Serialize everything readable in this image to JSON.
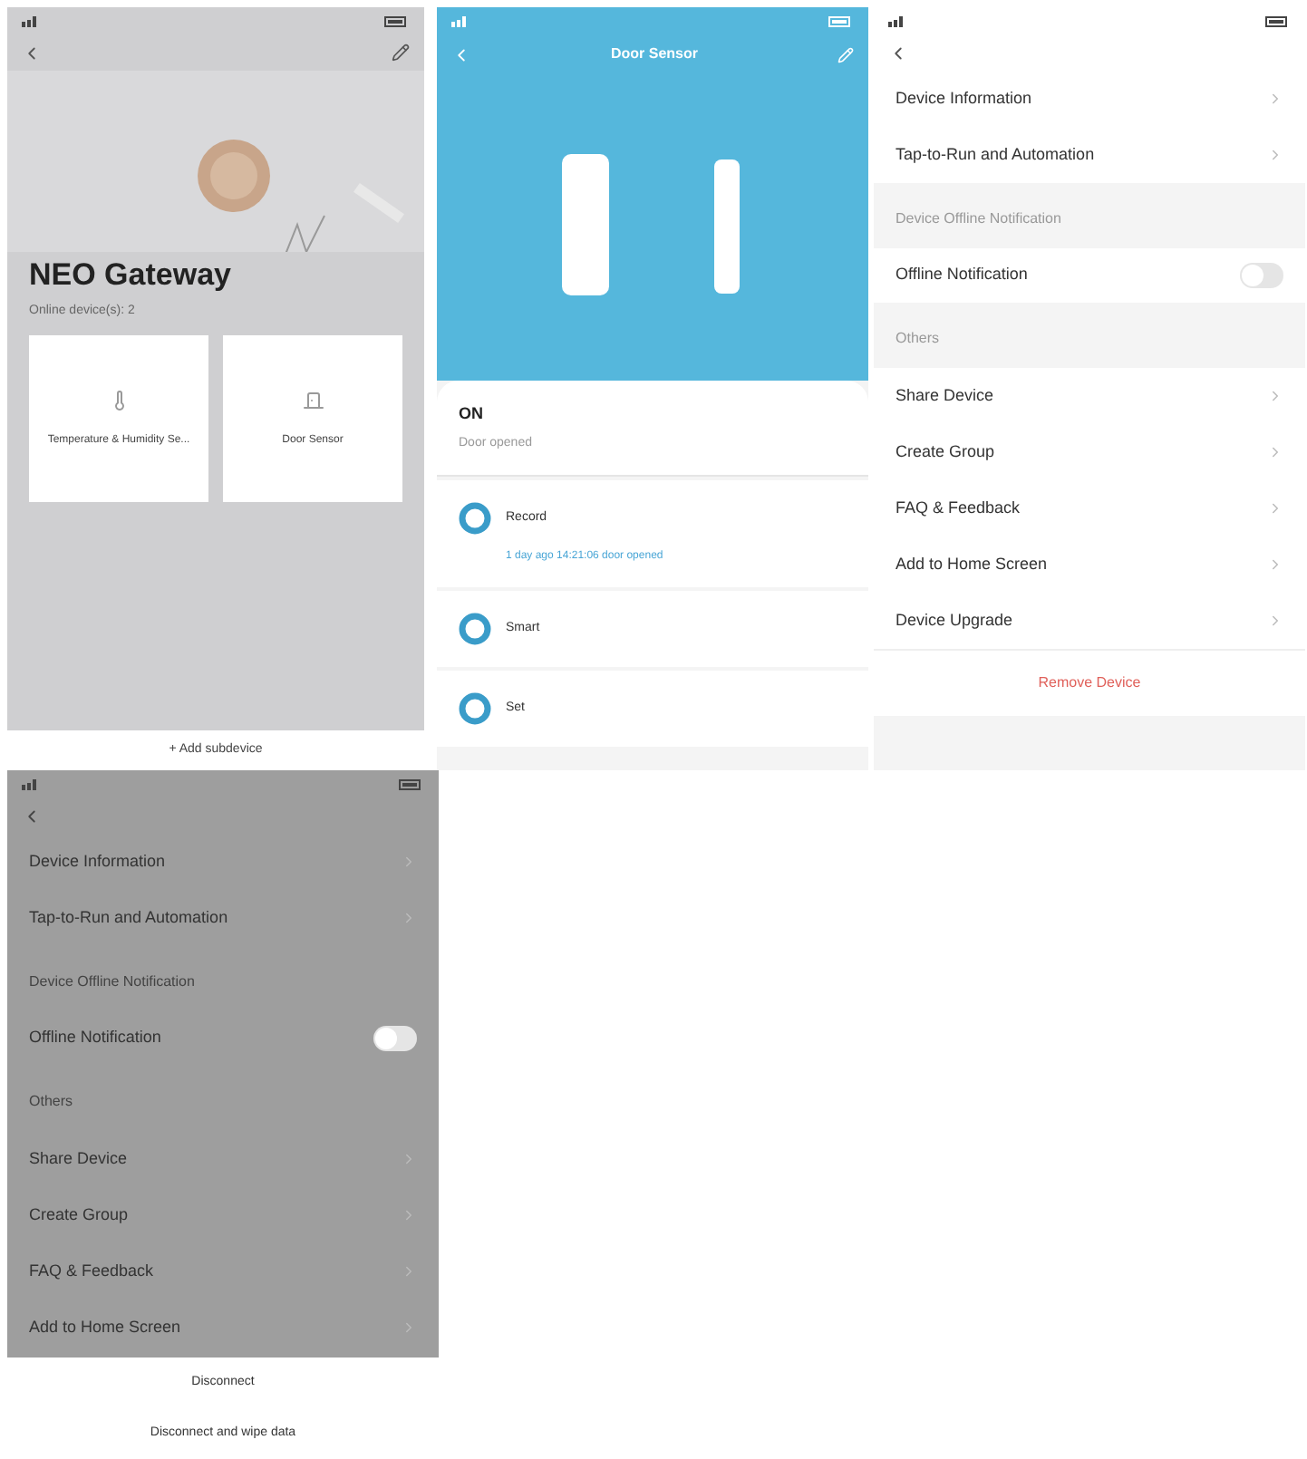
{
  "gateway": {
    "title": "NEO Gateway",
    "subtitle": "Online device(s): 2",
    "devices": [
      {
        "name": "Temperature & Humidity Se..."
      },
      {
        "name": "Door Sensor"
      }
    ],
    "add_button": "+ Add subdevice"
  },
  "sensor": {
    "title": "Door Sensor",
    "status": {
      "value": "ON",
      "label": "Door opened"
    },
    "rows": [
      {
        "label": "Record",
        "detail": "1 day ago 14:21:06 door opened"
      },
      {
        "label": "Smart"
      },
      {
        "label": "Set"
      }
    ]
  },
  "settings": {
    "items": [
      {
        "kind": "link",
        "label": "Device Information"
      },
      {
        "kind": "link",
        "label": "Tap-to-Run and Automation"
      },
      {
        "kind": "section",
        "label": "Device Offline Notification"
      },
      {
        "kind": "toggle",
        "label": "Offline Notification",
        "on": false
      },
      {
        "kind": "section",
        "label": "Others"
      },
      {
        "kind": "link",
        "label": "Share Device"
      },
      {
        "kind": "link",
        "label": "Create Group"
      },
      {
        "kind": "link",
        "label": "FAQ & Feedback"
      },
      {
        "kind": "link",
        "label": "Add to Home Screen"
      },
      {
        "kind": "link",
        "label": "Device Upgrade"
      }
    ],
    "remove_button": "Remove Device"
  },
  "action_sheet": {
    "items": [
      {
        "kind": "link",
        "label": "Device Information"
      },
      {
        "kind": "link",
        "label": "Tap-to-Run and Automation"
      },
      {
        "kind": "section",
        "label": "Device Offline Notification"
      },
      {
        "kind": "toggle",
        "label": "Offline Notification",
        "on": false
      },
      {
        "kind": "section",
        "label": "Others"
      },
      {
        "kind": "link",
        "label": "Share Device"
      },
      {
        "kind": "link",
        "label": "Create Group"
      },
      {
        "kind": "link",
        "label": "FAQ & Feedback"
      },
      {
        "kind": "link",
        "label": "Add to Home Screen"
      }
    ],
    "options": [
      "Disconnect",
      "Disconnect and wipe data"
    ]
  }
}
